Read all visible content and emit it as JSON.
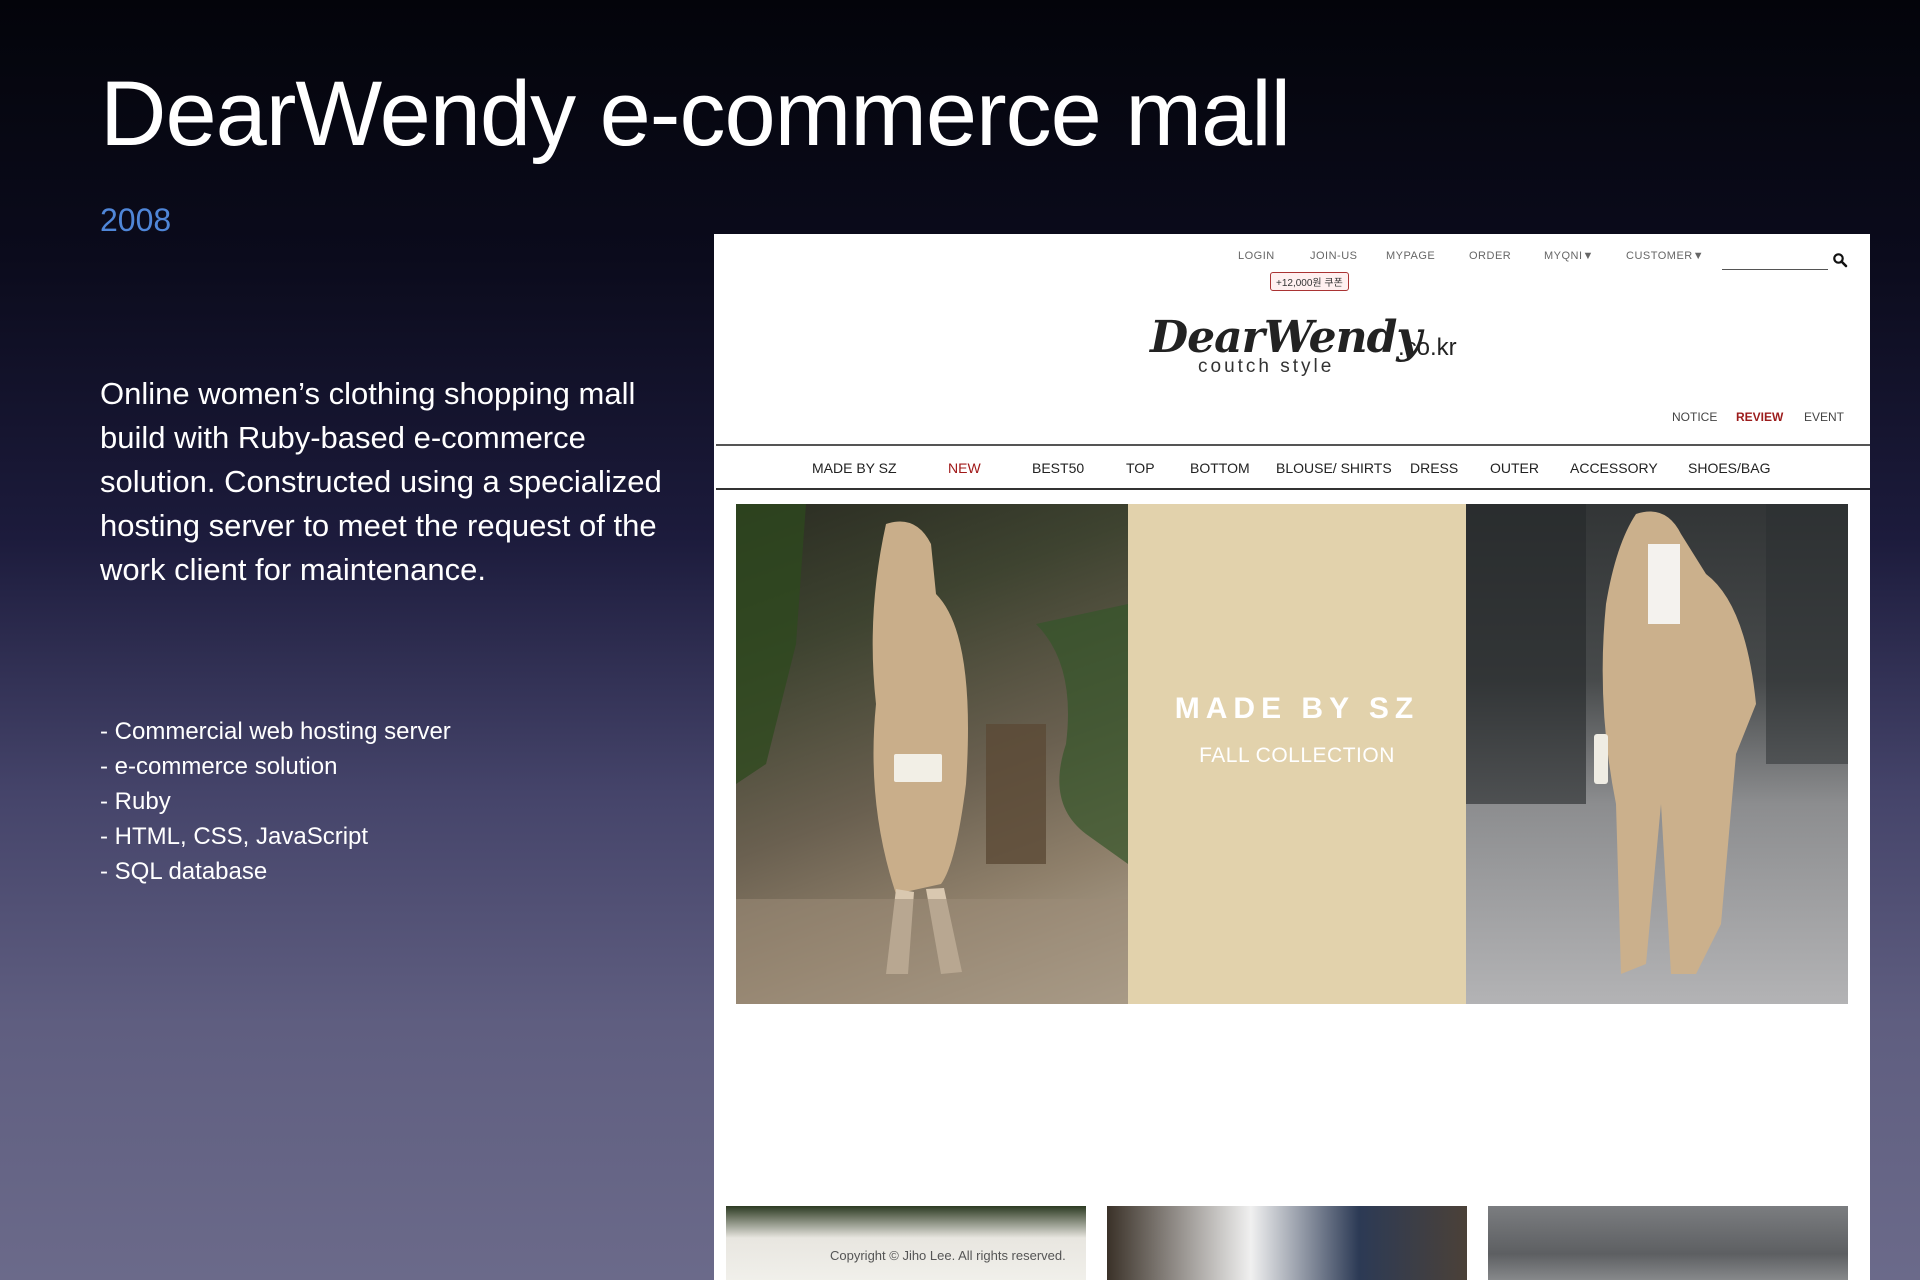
{
  "slide": {
    "title": "DearWendy e-commerce mall",
    "year": "2008",
    "description": "Online women’s clothing shopping mall build with Ruby-based e-commerce solution. Constructed using a specialized hosting server to meet the request of the work client for maintenance.",
    "tech": [
      "- Commercial web hosting server",
      "- e-commerce solution",
      "- Ruby",
      "- HTML, CSS, JavaScript",
      "- SQL database"
    ]
  },
  "site": {
    "top_nav": {
      "login": "LOGIN",
      "join": "JOIN-US",
      "mypage": "MYPAGE",
      "order": "ORDER",
      "myqni": "MYQNI▼",
      "customer": "CUSTOMER▼",
      "coupon": "+12,000원 쿠폰"
    },
    "logo": {
      "name": "DearWendy",
      "domain": ".co.kr",
      "tagline": "coutch style"
    },
    "sub_nav": {
      "notice": "NOTICE",
      "review": "REVIEW",
      "event": "EVENT"
    },
    "categories": [
      "MADE BY SZ",
      "NEW",
      "BEST50",
      "TOP",
      "BOTTOM",
      "BLOUSE/ SHIRTS",
      "DRESS",
      "OUTER",
      "ACCESSORY",
      "SHOES/BAG"
    ],
    "banner": {
      "title": "MADE BY SZ",
      "subtitle": "FALL COLLECTION"
    },
    "copyright": "Copyright © Jiho Lee. All rights reserved."
  },
  "colors": {
    "accent_red": "#a01818",
    "year_blue": "#4f86d8",
    "banner_beige": "#e2d2ac"
  }
}
